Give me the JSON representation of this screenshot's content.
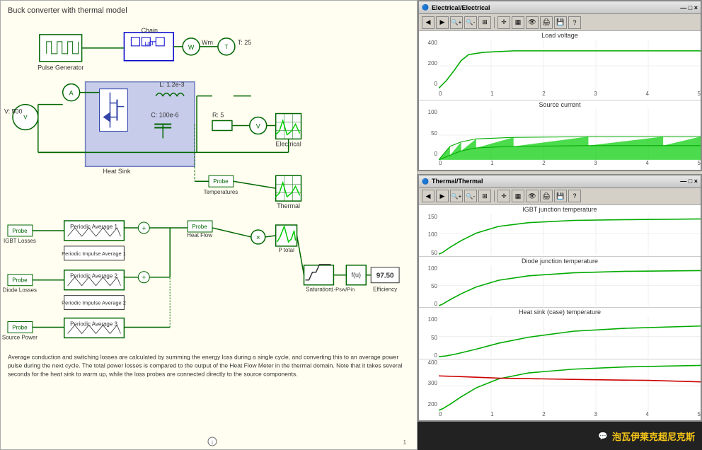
{
  "app": {
    "title": "Buck converter with thermal model"
  },
  "diagram": {
    "title": "Buck converter with thermal model",
    "components": {
      "pulse_generator": "Pulse Generator",
      "thermal_chain": "Thermal Chain",
      "wm_label": "Wm",
      "temp_label": "T: 25",
      "voltage_source": "V: 500",
      "ammeter": "A",
      "inductor": "L: 1.2e-3",
      "capacitor": "C: 100e-6",
      "resistor": "R: 5",
      "heat_sink": "Heat Sink",
      "electrical_label": "Electrical",
      "probe_label": "Probe",
      "temperatures_label": "Temperatures",
      "thermal_label": "Thermal",
      "probe_igbt": "Probe\nIGBT Losses",
      "periodic_avg1": "Periodic Average 1",
      "periodic_imp1": "Periodic Impulse Average 1",
      "probe_heat_flow": "Probe\nHeat Flow",
      "p_total": "P total",
      "probe_diode": "Probe\nDiode Losses",
      "periodic_avg2": "Periodic Average 2",
      "periodic_imp2": "Periodic Impulse Average 2",
      "saturation": "Saturation",
      "fu_label": "f(u)",
      "efficiency_val": "97.50",
      "label_1psw": "1-Psw/Pin",
      "efficiency_label": "Efficiency",
      "probe_source": "Probe\nSource Power",
      "periodic_avg3": "Periodic Average 3"
    },
    "description": "Average conduction and switching losses are calculated by summing the energy loss during a single cycle, and converting this to an average power pulse during the next cycle. The total power losses is compared to the output of the Heat Flow Meter in the thermal domain. Note that it takes several seconds for the heat sink to warm up, while the loss probes are connected directly to the source components."
  },
  "scope1": {
    "title": "Electrical/Electrical",
    "plots": [
      {
        "title": "Load voltage",
        "y_max": "400",
        "y_mid": "200",
        "y_min": "0",
        "curve_color": "#00aa00",
        "curve_type": "flat_high"
      },
      {
        "title": "Source current",
        "y_max": "100",
        "y_mid": "50",
        "y_min": "0",
        "curve_color": "#00aa00",
        "curve_type": "filled_band"
      }
    ],
    "x_labels": [
      "0",
      "1",
      "2",
      "3",
      "4",
      "5"
    ]
  },
  "scope2": {
    "title": "Thermal/Thermal",
    "plots": [
      {
        "title": "IGBT junction temperature",
        "y_max": "150",
        "y_mid": "100",
        "y_min": "50",
        "curve_color": "#00aa00",
        "curve_type": "rise"
      },
      {
        "title": "Diode junction temperature",
        "y_max": "100",
        "y_mid": "50",
        "y_min": "0",
        "curve_color": "#00aa00",
        "curve_type": "rise"
      },
      {
        "title": "Heat sink (case) temperature",
        "y_max": "100",
        "y_mid": "50",
        "y_min": "0",
        "curve_color": "#00aa00",
        "curve_type": "rise_slow"
      }
    ],
    "x_labels": [
      "0",
      "1",
      "2",
      "3",
      "4",
      "5"
    ],
    "bottom_plot": {
      "y_max": "400",
      "y_mid": "300",
      "y_min": "200",
      "curves": [
        "green_rise",
        "red_flat"
      ]
    }
  },
  "toolbar": {
    "buttons": [
      "←",
      "→",
      "🔍+",
      "🔍-",
      "⊞",
      "✚",
      "📊",
      "👁",
      "🖨",
      "💾",
      "❓"
    ]
  },
  "watermark": {
    "text": "泡瓦伊莱克超尼克斯"
  }
}
